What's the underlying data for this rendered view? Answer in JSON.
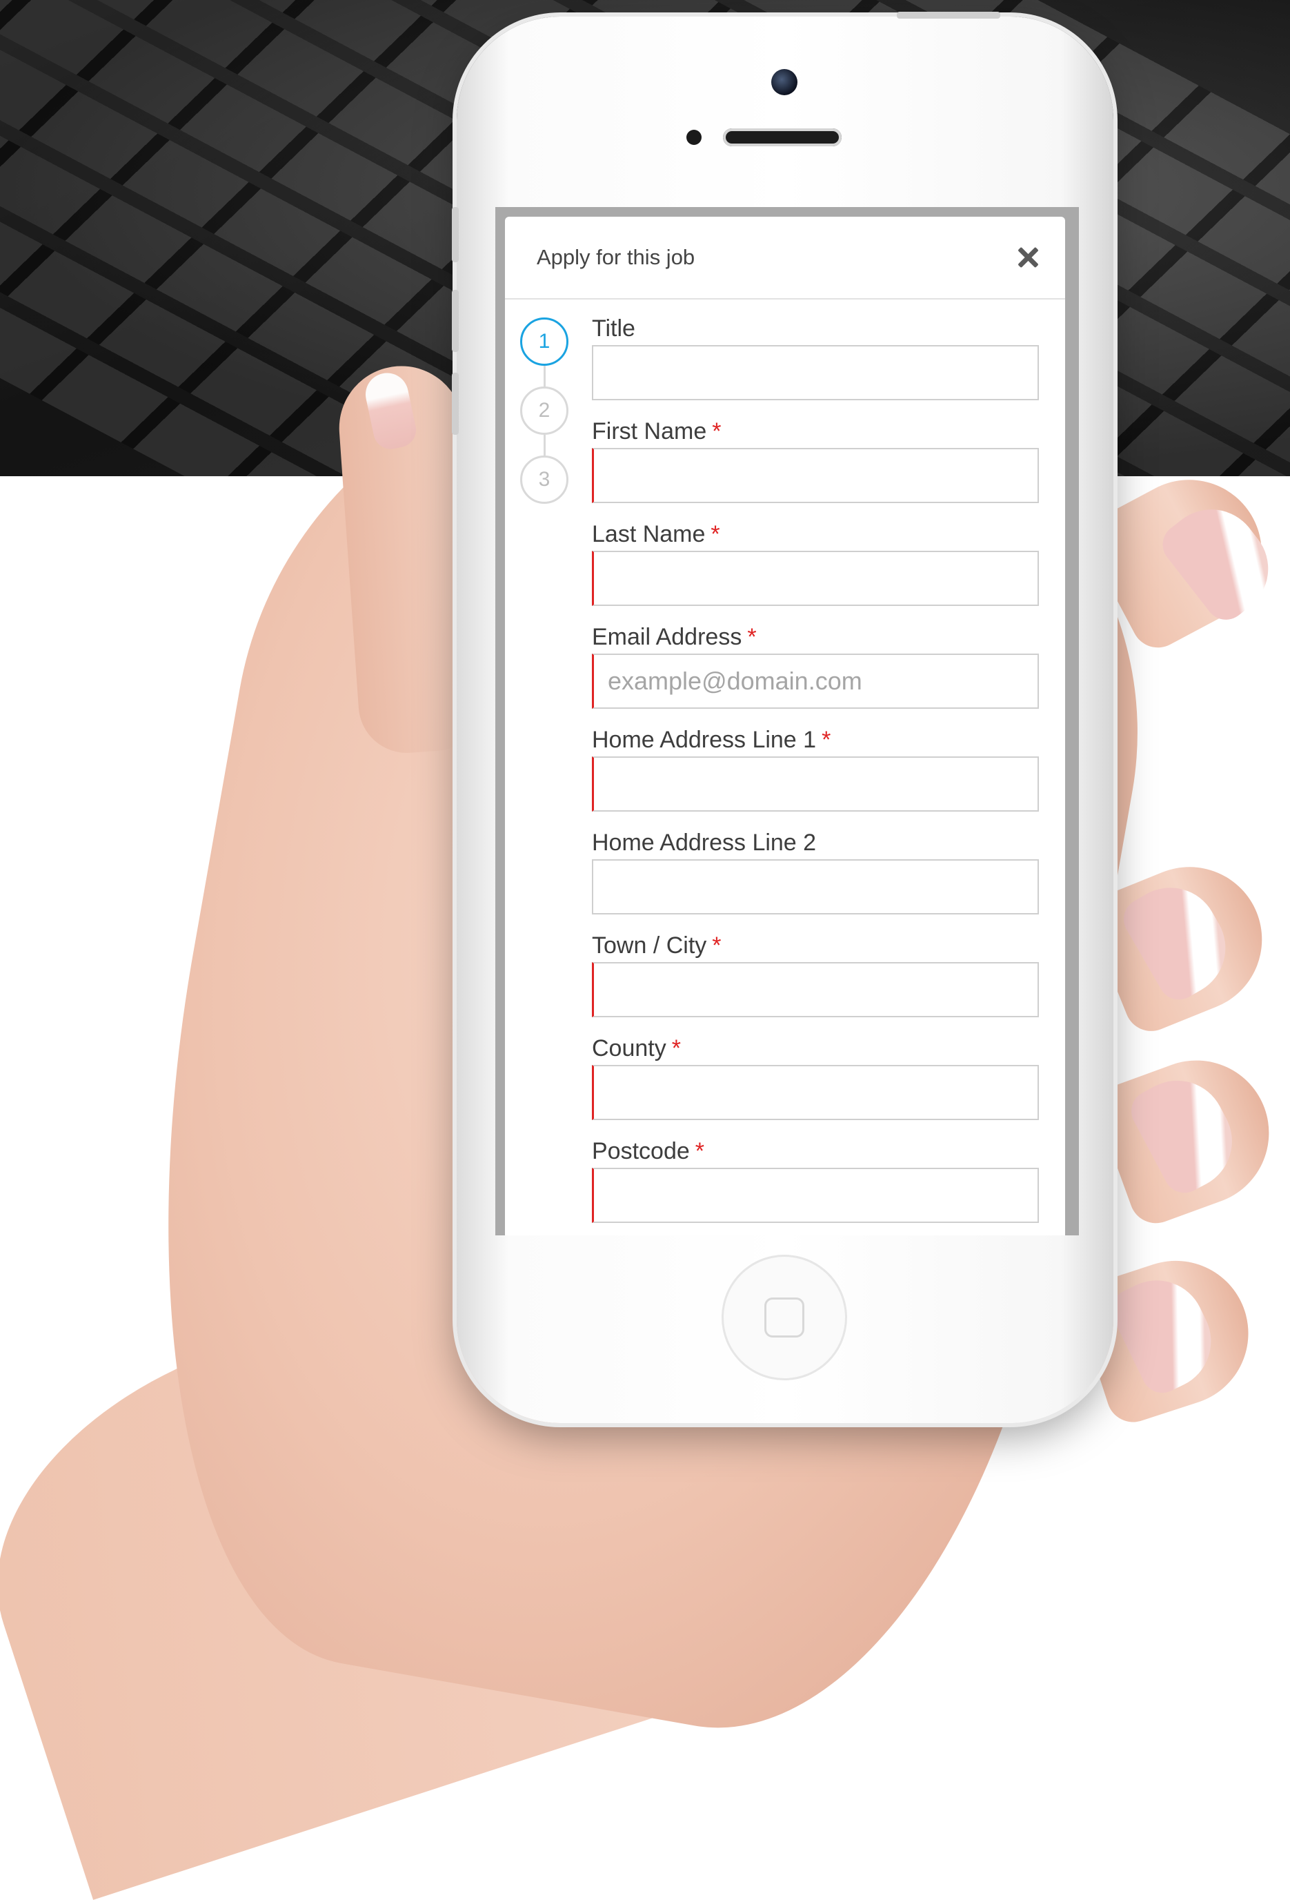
{
  "modal": {
    "title": "Apply for this job",
    "close_icon": "close-icon"
  },
  "steps": [
    "1",
    "2",
    "3"
  ],
  "active_step": 1,
  "form": {
    "fields": [
      {
        "label": "Title",
        "required": false,
        "value": "",
        "placeholder": ""
      },
      {
        "label": "First Name",
        "required": true,
        "value": "",
        "placeholder": ""
      },
      {
        "label": "Last Name",
        "required": true,
        "value": "",
        "placeholder": ""
      },
      {
        "label": "Email Address",
        "required": true,
        "value": "",
        "placeholder": "example@domain.com"
      },
      {
        "label": "Home Address Line 1",
        "required": true,
        "value": "",
        "placeholder": ""
      },
      {
        "label": "Home Address Line 2",
        "required": false,
        "value": "",
        "placeholder": ""
      },
      {
        "label": "Town / City",
        "required": true,
        "value": "",
        "placeholder": ""
      },
      {
        "label": "County",
        "required": true,
        "value": "",
        "placeholder": ""
      },
      {
        "label": "Postcode",
        "required": true,
        "value": "",
        "placeholder": ""
      }
    ],
    "required_marker": "*"
  },
  "colors": {
    "accent": "#1aa3e1",
    "required": "#e02424",
    "border": "#cfcfcf"
  }
}
